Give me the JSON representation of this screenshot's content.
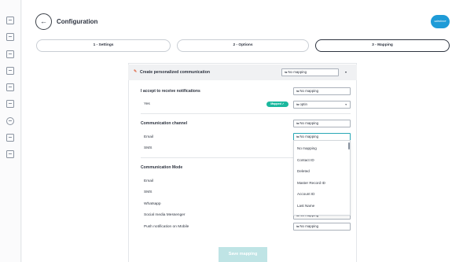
{
  "header": {
    "title": "Configuration",
    "back_icon": "←",
    "logo_text": "salesforce"
  },
  "steps": [
    {
      "label": "1 - Settings"
    },
    {
      "label": "2 - Options"
    },
    {
      "label": "3 - Mapping"
    }
  ],
  "card": {
    "title": "Create personalized communication",
    "title_icon": "✎",
    "title_mapping": "No mapping",
    "sections": {
      "notifications": {
        "header": "I accept to receive notifications",
        "header_mapping": "No mapping",
        "rows": [
          {
            "label": "Yes",
            "badge": "Mapped ✓",
            "mapping": "optin"
          }
        ]
      },
      "channel": {
        "header": "Communication channel",
        "header_mapping": "No mapping",
        "rows": [
          {
            "label": "Email",
            "mapping": "No mapping"
          },
          {
            "label": "SMS"
          }
        ]
      },
      "mode": {
        "header": "Communication Mode",
        "rows": [
          {
            "label": "Email"
          },
          {
            "label": "SMS"
          },
          {
            "label": "Whatsapp"
          },
          {
            "label": "Social media Messenger",
            "mapping": "No mapping"
          },
          {
            "label": "Push notification on Mobile",
            "mapping": "No mapping"
          }
        ]
      }
    }
  },
  "dropdown": {
    "options": [
      "No mapping",
      "Contact ID",
      "Deleted",
      "Master Record ID",
      "Account ID",
      "Last Name"
    ]
  },
  "mapping_icon": "⇆",
  "footer": {
    "save_label": "Save mapping"
  },
  "colors": {
    "accent": "#1bb89e",
    "focus": "#2aa8b6",
    "save_bg": "#bfe4e5",
    "logo": "#1e9bd7"
  },
  "sidebar_icons": [
    "grid-icon",
    "inbox-icon",
    "image-icon",
    "document-icon",
    "edit-icon",
    "chart-icon",
    "clock-icon",
    "book-icon",
    "calendar-icon"
  ]
}
